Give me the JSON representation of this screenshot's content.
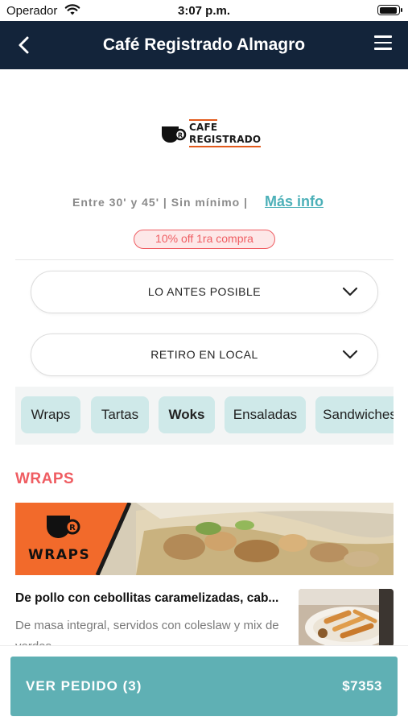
{
  "status_bar": {
    "carrier": "Operador",
    "time": "3:07 p.m."
  },
  "nav": {
    "title": "Café Registrado Almagro"
  },
  "store": {
    "logo_line1": "CAFE",
    "logo_line2": "REGISTRADO",
    "info": "Entre 30' y 45' | Sin mínimo |",
    "more_info_link": "Más info",
    "promo_badge": "10% off 1ra compra"
  },
  "filters": {
    "time_option": "LO ANTES POSIBLE",
    "delivery_option": "RETIRO EN LOCAL"
  },
  "categories": [
    {
      "label": "Wraps"
    },
    {
      "label": "Tartas"
    },
    {
      "label": "Woks"
    },
    {
      "label": "Ensaladas"
    },
    {
      "label": "Sandwiches"
    }
  ],
  "section": {
    "title": "WRAPS",
    "banner_text": "WRAPS"
  },
  "product": {
    "name": "De pollo con cebollitas caramelizadas, cab...",
    "description": "De masa integral, servidos con coleslaw y mix de verdes"
  },
  "order": {
    "label": "VER PEDIDO (3)",
    "total": "$7353"
  },
  "colors": {
    "nav_bg": "#13243a",
    "accent_teal": "#5fb0b4",
    "accent_red": "#ef5d62",
    "brand_orange": "#e25a1c"
  }
}
